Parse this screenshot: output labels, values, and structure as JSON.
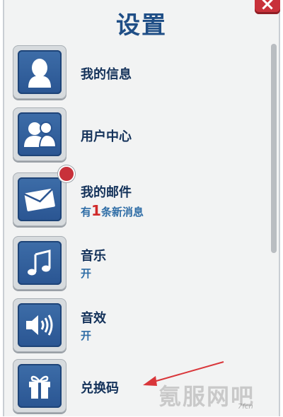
{
  "header": {
    "title": "设置",
    "close_symbol": "×"
  },
  "menu": {
    "items": [
      {
        "label": "我的信息",
        "icon": "user-profile-icon"
      },
      {
        "label": "用户中心",
        "icon": "users-icon"
      },
      {
        "label": "我的邮件",
        "icon": "mail-icon",
        "status_prefix": "有",
        "status_count": "1",
        "status_suffix": "条新消息",
        "badge": true
      },
      {
        "label": "音乐",
        "icon": "music-note-icon",
        "status": "开"
      },
      {
        "label": "音效",
        "icon": "speaker-icon",
        "status": "开"
      },
      {
        "label": "兑换码",
        "icon": "gift-icon"
      }
    ]
  },
  "watermark": {
    "text": "氪服网吧",
    "sub": "7fcn"
  },
  "colors": {
    "title": "#1f4e86",
    "icon_bg": "#2f5f9e",
    "badge": "#c8313a",
    "arrow": "#d9363a",
    "status": "#2f6da6"
  }
}
